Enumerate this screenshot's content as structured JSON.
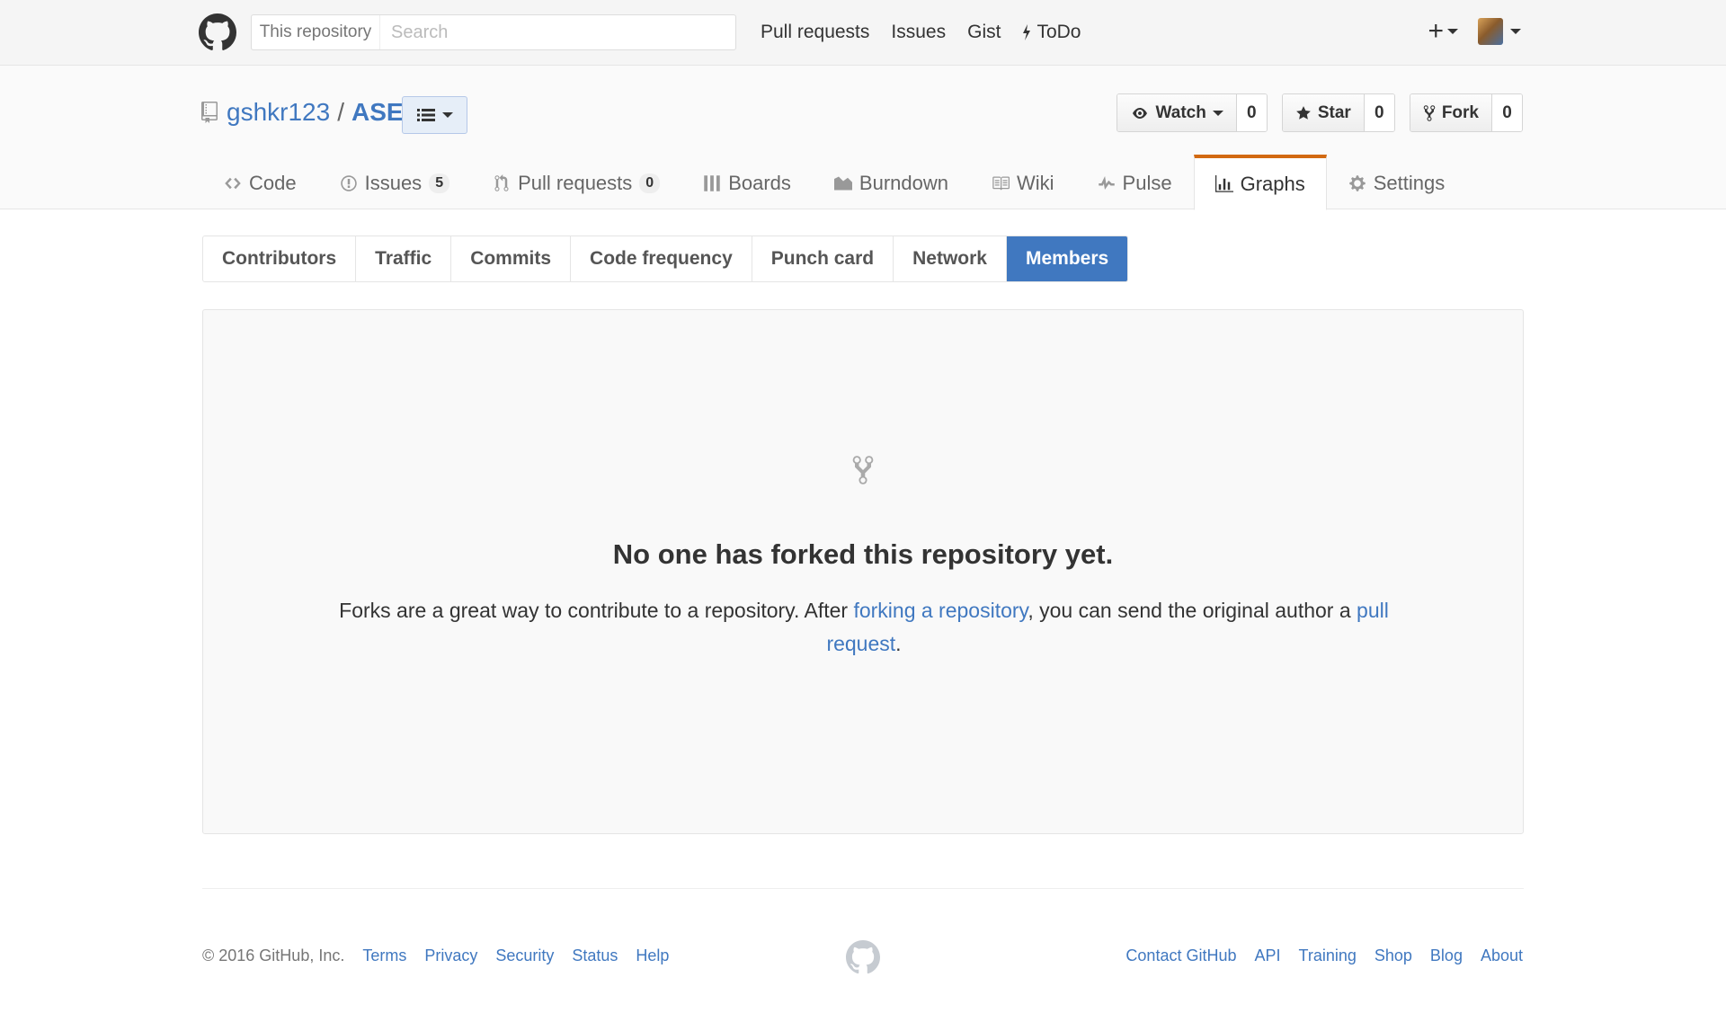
{
  "header": {
    "search_scope": "This repository",
    "search_placeholder": "Search",
    "nav": [
      "Pull requests",
      "Issues",
      "Gist",
      "ToDo"
    ],
    "new_menu_label": "+"
  },
  "repo": {
    "owner": "gshkr123",
    "separator": "/",
    "name": "ASE",
    "watch": {
      "label": "Watch",
      "count": "0"
    },
    "star": {
      "label": "Star",
      "count": "0"
    },
    "fork": {
      "label": "Fork",
      "count": "0"
    }
  },
  "reponav": [
    {
      "label": "Code",
      "icon": "code-icon"
    },
    {
      "label": "Issues",
      "count": "5",
      "icon": "issue-icon"
    },
    {
      "label": "Pull requests",
      "count": "0",
      "icon": "pull-request-icon"
    },
    {
      "label": "Boards",
      "icon": "boards-icon"
    },
    {
      "label": "Burndown",
      "icon": "burndown-icon"
    },
    {
      "label": "Wiki",
      "icon": "book-icon"
    },
    {
      "label": "Pulse",
      "icon": "pulse-icon"
    },
    {
      "label": "Graphs",
      "icon": "graph-icon",
      "selected": true
    },
    {
      "label": "Settings",
      "icon": "gear-icon"
    }
  ],
  "subnav": [
    "Contributors",
    "Traffic",
    "Commits",
    "Code frequency",
    "Punch card",
    "Network",
    "Members"
  ],
  "subnav_selected": "Members",
  "blankslate": {
    "title": "No one has forked this repository yet.",
    "text_1": "Forks are a great way to contribute to a repository. After ",
    "link_1": "forking a repository",
    "text_2": ", you can send the original author a ",
    "link_2": "pull request",
    "text_3": "."
  },
  "footer": {
    "copyright": "© 2016 GitHub, Inc.",
    "left_links": [
      "Terms",
      "Privacy",
      "Security",
      "Status",
      "Help"
    ],
    "right_links": [
      "Contact GitHub",
      "API",
      "Training",
      "Shop",
      "Blog",
      "About"
    ]
  },
  "colors": {
    "accent": "#4078c0",
    "selected_tab_border": "#d26911"
  }
}
